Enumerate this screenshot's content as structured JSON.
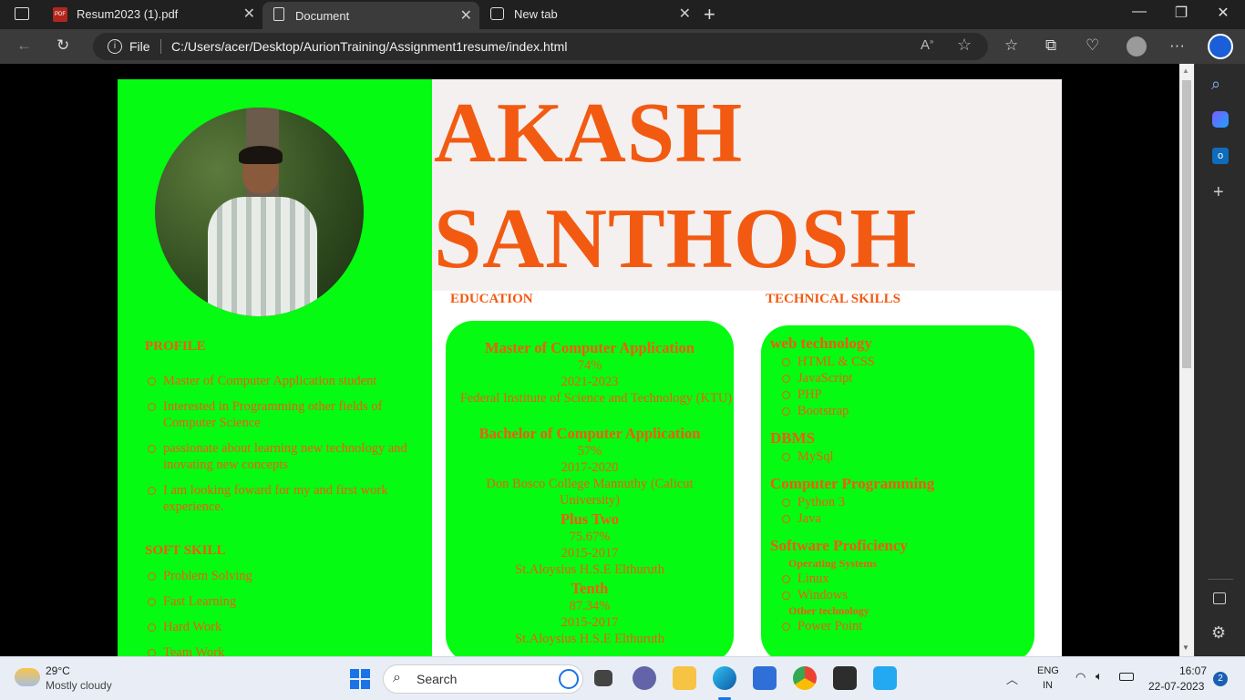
{
  "browser": {
    "tabs": [
      {
        "label": "Resum2023 (1).pdf"
      },
      {
        "label": "Document"
      },
      {
        "label": "New tab"
      }
    ],
    "address": {
      "scheme_label": "File",
      "url": "C:/Users/acer/Desktop/AurionTraining/Assignment1resume/index.html"
    }
  },
  "resume": {
    "first_name": "AKASH",
    "last_name": "SANTHOSH",
    "profile": {
      "heading": "PROFILE",
      "items": [
        "Master of Computer Application student",
        "Interested in Programming other fields of Computer Science",
        "passionate about learning new technology and inovating new concepts",
        "I am looking foward for my and first work experience."
      ]
    },
    "soft_skill": {
      "heading": "SOFT SKILL",
      "items": [
        "Problem Solving",
        "Fast Learning",
        "Hard Work",
        "Team Work"
      ]
    },
    "education": {
      "heading": "EDUCATION",
      "entries": [
        {
          "title": "Master of Computer Application",
          "score": "74%",
          "years": "2021-2023",
          "institution": "Federal Institute of Science and Technology (KTU)"
        },
        {
          "title": "Bachelor of Computer Application",
          "score": "57%",
          "years": "2017-2020",
          "institution": "Don Bosco College Mannuthy (Calicut University)"
        },
        {
          "title": "Plus Two",
          "score": "75.67%",
          "years": "2015-2017",
          "institution": "St.Aloysius H.S.E Elthuruth"
        },
        {
          "title": "Tenth",
          "score": "87.34%",
          "years": "2015-2017",
          "institution": "St.Aloysius H.S.E Elthuruth"
        }
      ]
    },
    "technical_skills": {
      "heading": "TECHNICAL SKILLS",
      "web_technology": {
        "heading": "web technology",
        "items": [
          "HTML & CSS",
          "JavaScript",
          "PHP",
          "Bootstrap"
        ]
      },
      "dbms": {
        "heading": "DBMS",
        "items": [
          "MySql"
        ]
      },
      "programming": {
        "heading": "Computer Programming",
        "items": [
          "Python 3",
          "Java"
        ]
      },
      "software": {
        "heading": "Software Proficiency",
        "os_heading": "Operating Systems",
        "os_items": [
          "Linux",
          "Windows"
        ],
        "other_heading": "Other technology",
        "other_items": [
          "Power Point"
        ]
      }
    }
  },
  "taskbar": {
    "weather_temp": "29°C",
    "weather_desc": "Mostly cloudy",
    "search_placeholder": "Search",
    "lang_1": "ENG",
    "lang_2": "IN",
    "time": "16:07",
    "date": "22-07-2023",
    "notifications": "2"
  },
  "colors": {
    "accent_orange": "#f25a12",
    "resume_green": "#05fb12"
  }
}
